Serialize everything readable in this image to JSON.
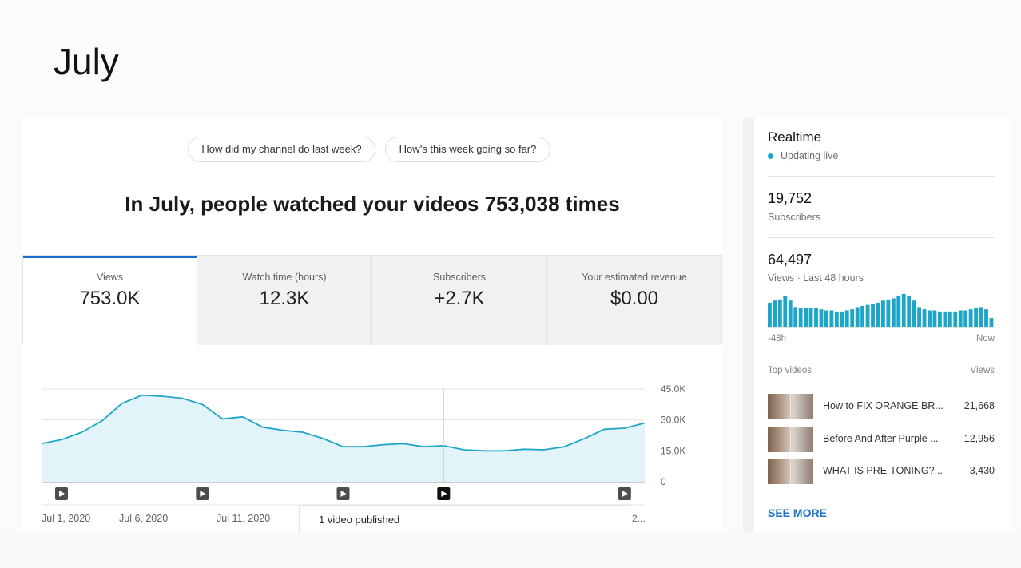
{
  "page": {
    "title": "July"
  },
  "suggestions": [
    "How did my channel do last week?",
    "How’s this week going so far?"
  ],
  "headline": "In July, people watched your videos 753,038 times",
  "metric_tabs": [
    {
      "label": "Views",
      "value": "753.0K",
      "active": true
    },
    {
      "label": "Watch time (hours)",
      "value": "12.3K",
      "active": false
    },
    {
      "label": "Subscribers",
      "value": "+2.7K",
      "active": false
    },
    {
      "label": "Your estimated revenue",
      "value": "$0.00",
      "active": false
    }
  ],
  "chart_data": {
    "type": "area",
    "title": "",
    "xlabel": "",
    "ylabel": "",
    "ylim": [
      0,
      45000
    ],
    "y_ticks": [
      "45.0K",
      "30.0K",
      "15.0K",
      "0"
    ],
    "x_tick_labels": [
      "Jul 1, 2020",
      "Jul 6, 2020",
      "Jul 11, 2020"
    ],
    "x": [
      1,
      2,
      3,
      4,
      5,
      6,
      7,
      8,
      9,
      10,
      11,
      12,
      13,
      14,
      15,
      16,
      17,
      18,
      19,
      20,
      21,
      22,
      23,
      24,
      25,
      26,
      27,
      28,
      29,
      30,
      31
    ],
    "values": [
      18500,
      20500,
      24000,
      29500,
      38000,
      42000,
      41500,
      40500,
      37500,
      30500,
      31500,
      26500,
      25000,
      24000,
      21000,
      17000,
      17000,
      18000,
      18500,
      17000,
      17500,
      15500,
      15000,
      15000,
      15800,
      15500,
      17000,
      21000,
      25500,
      26000,
      28500
    ],
    "series_color": "#1ea6c8",
    "fill_color": "#e2f3f9",
    "grid": true,
    "video_published_markers": [
      1,
      9,
      16,
      21,
      30
    ],
    "highlighted_marker": 21,
    "tooltip": {
      "text": "1 video published",
      "more": "2..."
    }
  },
  "sidebar": {
    "title": "Realtime",
    "status": "Updating live",
    "subscribers": {
      "value": "19,752",
      "label": "Subscribers"
    },
    "views": {
      "value": "64,497",
      "label": "Views · Last 48 hours"
    },
    "bars": [
      22,
      24,
      25,
      28,
      24,
      18,
      17,
      17,
      17,
      17,
      16,
      15,
      15,
      14,
      14,
      15,
      16,
      18,
      19,
      20,
      21,
      22,
      24,
      25,
      26,
      28,
      30,
      28,
      24,
      18,
      16,
      15,
      15,
      14,
      14,
      14,
      14,
      15,
      15,
      16,
      17,
      18,
      16,
      8
    ],
    "bar_color": "#1ea6c8",
    "range_start": "-48h",
    "range_end": "Now",
    "top_videos_label": "Top videos",
    "views_col_label": "Views",
    "videos": [
      {
        "title": "How to FIX ORANGE BR...",
        "views": "21,668"
      },
      {
        "title": "Before And After Purple ...",
        "views": "12,956"
      },
      {
        "title": "WHAT IS PRE-TONING? ...",
        "views": "3,430"
      }
    ],
    "see_more": "SEE MORE"
  }
}
